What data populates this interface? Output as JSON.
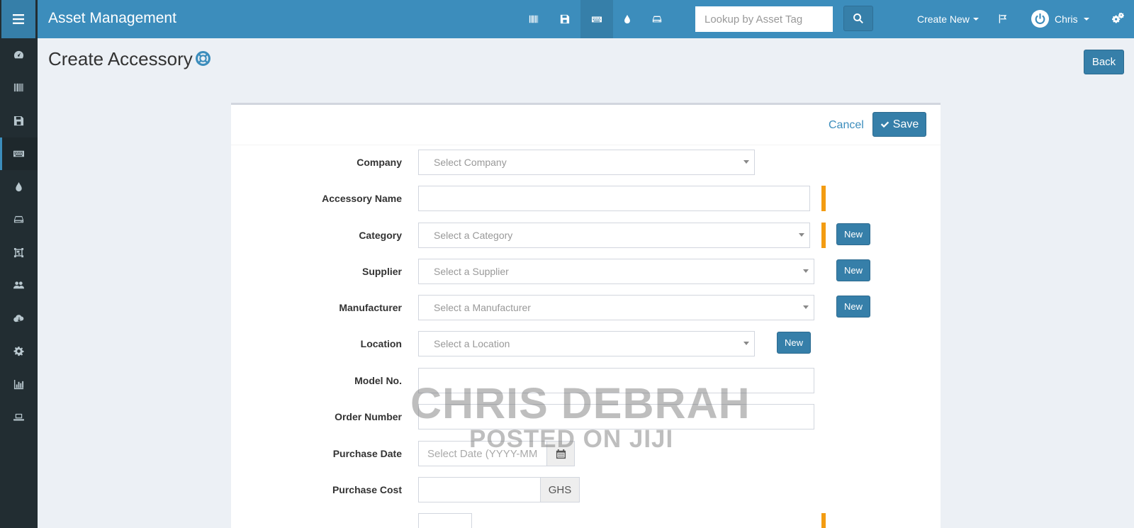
{
  "app": {
    "title": "Asset Management"
  },
  "header": {
    "search_placeholder": "Lookup by Asset Tag",
    "create_new_label": "Create New",
    "user_name": "Chris",
    "icons": [
      "barcode-icon",
      "save-icon",
      "keyboard-icon",
      "tint-icon",
      "hdd-icon"
    ]
  },
  "sidebar": {
    "icons": [
      "dashboard-icon",
      "barcode-icon",
      "save-icon",
      "keyboard-icon",
      "tint-icon",
      "hdd-icon",
      "object-group-icon",
      "users-icon",
      "cloud-download-icon",
      "cog-icon",
      "bar-chart-icon",
      "laptop-icon"
    ],
    "active": "keyboard-icon"
  },
  "page": {
    "title": "Create Accessory",
    "back_label": "Back"
  },
  "form": {
    "cancel_label": "Cancel",
    "save_label": "Save",
    "new_label": "New",
    "fields": {
      "company": {
        "label": "Company",
        "placeholder": "Select Company"
      },
      "accessory_name": {
        "label": "Accessory Name",
        "value": ""
      },
      "category": {
        "label": "Category",
        "placeholder": "Select a Category"
      },
      "supplier": {
        "label": "Supplier",
        "placeholder": "Select a Supplier"
      },
      "manufacturer": {
        "label": "Manufacturer",
        "placeholder": "Select a Manufacturer"
      },
      "location": {
        "label": "Location",
        "placeholder": "Select a Location"
      },
      "model_no": {
        "label": "Model No.",
        "value": ""
      },
      "order_number": {
        "label": "Order Number",
        "value": ""
      },
      "purchase_date": {
        "label": "Purchase Date",
        "placeholder": "Select Date (YYYY-MM-DD)"
      },
      "purchase_cost": {
        "label": "Purchase Cost",
        "currency": "GHS"
      }
    }
  },
  "watermark": {
    "line1": "CHRIS DEBRAH",
    "line2": "POSTED ON JIJI"
  },
  "colors": {
    "header": "#3c8dbc",
    "sidebar": "#222d32",
    "primary_button": "#367fa9",
    "required_marker": "#f39c12",
    "background": "#ecf0f5"
  }
}
